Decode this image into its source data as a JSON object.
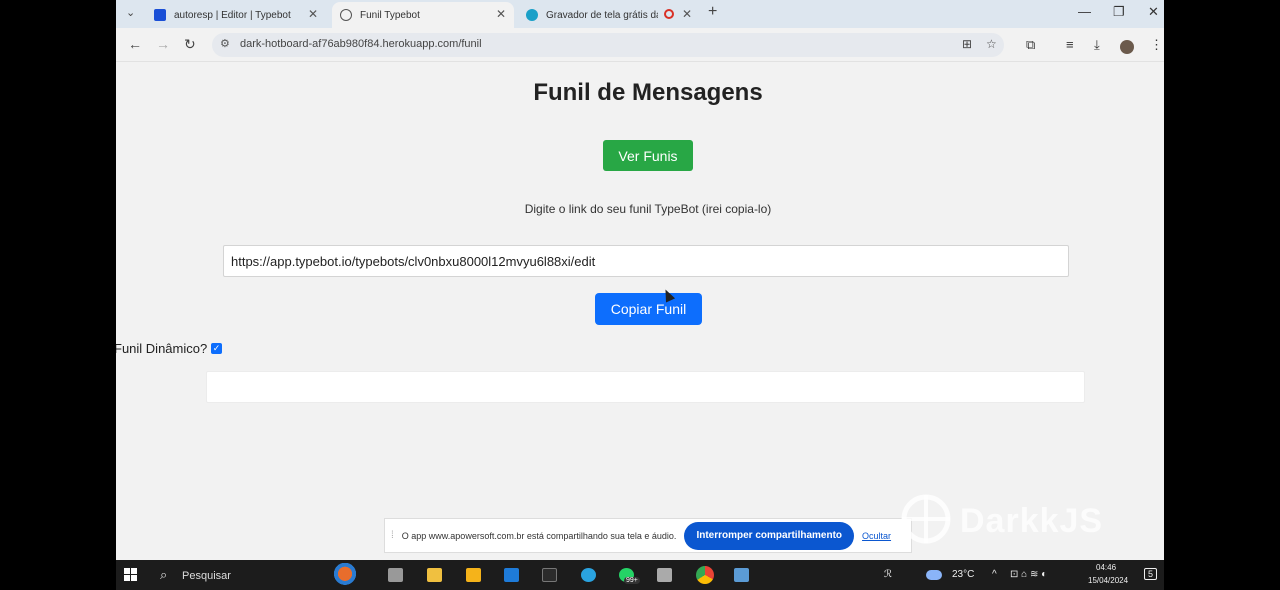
{
  "browser": {
    "tabs": [
      {
        "title": "autoresp | Editor | Typebot",
        "favicon_color": "#1a4fd6"
      },
      {
        "title": "Funil Typebot",
        "favicon_color": "#555555",
        "active": true
      },
      {
        "title": "Gravador de tela grátis da",
        "favicon_color": "#1aa0c8"
      }
    ],
    "url": "dark-hotboard-af76ab980f84.herokuapp.com/funil"
  },
  "page": {
    "title": "Funil de Mensagens",
    "ver_funis_label": "Ver Funis",
    "instruction": "Digite o link do seu funil TypeBot (irei copia-lo)",
    "funnel_link_value": "https://app.typebot.io/typebots/clv0nbxu8000l12mvyu6l88xi/edit",
    "copiar_label": "Copiar Funil",
    "dynamic_label": "Funil Dinâmico?",
    "dynamic_checked": true
  },
  "share_notice": {
    "message": "O app www.apowersoft.com.br está compartilhando sua tela e áudio.",
    "stop_label": "Interromper compartilhamento",
    "hide_label": "Ocultar"
  },
  "watermark": "DarkkJS",
  "taskbar": {
    "search_placeholder": "Pesquisar",
    "whatsapp_badge": "99+",
    "weather": "23°C",
    "time": "04:46",
    "date": "15/04/2024",
    "notification_count": "5"
  },
  "colors": {
    "green_button": "#28a745",
    "blue_button": "#0d6efd",
    "share_button": "#0b57d0"
  }
}
